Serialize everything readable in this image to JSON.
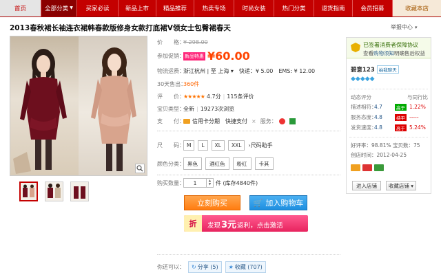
{
  "nav": {
    "home": "首页",
    "all_categories": "全部分类",
    "items": [
      "买家必读",
      "新品上市",
      "精品推荐",
      "热卖专场",
      "时尚女装",
      "热门分类",
      "退货指南",
      "会员招募"
    ],
    "favorite": "收藏本店"
  },
  "product": {
    "title": "2013春秋裙长袖连衣裙韩春款版修身女款打底裙V领女士包臀裙春天",
    "report": "举报中心"
  },
  "details": {
    "price_label": "价　　格：",
    "price_old": "¥ 298.00",
    "promo_label": "参加促销：",
    "promo_tag": "新品特惠",
    "price_new": "¥60.00",
    "ship_label": "物流运费：",
    "ship_value": "浙江杭州 | 至 上海 ▾　快递：¥ 5.00　EMS: ¥ 12.00",
    "sold_label": "30天售出：",
    "sold_value": "360件",
    "review_label": "评　　价：",
    "review_stars": "★★★★★",
    "review_score": "4.7分",
    "review_count": "115条评价",
    "type_label": "宝贝类型：",
    "type_value": "全新",
    "views": "19273次浏览",
    "pay_label": "支　　付：",
    "pay_value": "信用卡分期　快捷支付",
    "service_label": "服务：",
    "size_label": "尺　　码：",
    "sizes": [
      "M",
      "L",
      "XL",
      "XXL"
    ],
    "size_help": "尺码助手",
    "color_label": "颜色分类：",
    "colors": [
      "黑色",
      "酒红色",
      "粉红",
      "卡其"
    ],
    "qty_label": "购买数量：",
    "qty_value": "1",
    "stock": "件 (库存4840件)",
    "buy_now": "立刻购买",
    "add_cart": "加入购物车",
    "cashback_badge": "折",
    "cashback_pre": "发现",
    "cashback_amount": "3元",
    "cashback_post": "返利，点击激活",
    "share_label": "你还可以：",
    "share": "分享 (5)",
    "collect": "收藏 (707)"
  },
  "seller": {
    "guard_title": "已签署消费者保障协议",
    "guard_sub_pre": "查看",
    "guard_sub_link": "购物须知",
    "guard_sub_post": "明确售后权益",
    "shop_name": "碧意123",
    "shop_tag": "拍我聊天",
    "diamonds": "◆◆◆◆◆",
    "rating_title": "动态评分",
    "compare_title": "与同行比",
    "ratings": [
      {
        "k": "描述相符：",
        "v": "4.7",
        "tag": "高于",
        "pct": "1.22%"
      },
      {
        "k": "服务态度：",
        "v": "4.8",
        "tag": "持平",
        "pct": "-----"
      },
      {
        "k": "发货速度：",
        "v": "4.8",
        "tag": "高于",
        "pct": "5.24%"
      }
    ],
    "good_rate": "好评率：98.81%",
    "item_count": "宝贝数：75",
    "created": "创店时间：2012-04-25",
    "enter_shop": "进入店铺",
    "fav_shop": "收藏店铺 ▾"
  }
}
